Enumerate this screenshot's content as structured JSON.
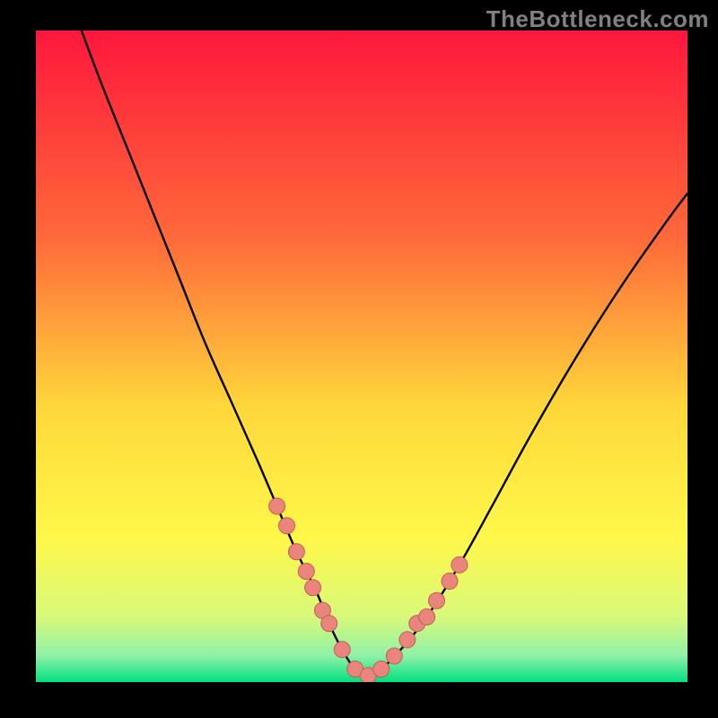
{
  "watermark": "TheBottleneck.com",
  "colors": {
    "frame": "#000000",
    "curve": "#000000",
    "dot_fill": "#e9857d",
    "dot_stroke": "#c25f56",
    "grad_top": "#ff173c",
    "grad_mid1": "#ff6a3a",
    "grad_mid2": "#ffd83a",
    "grad_mid3": "#fff84a",
    "grad_low1": "#d8f97a",
    "grad_low2": "#8ff1a8",
    "grad_bottom": "#00e07e"
  },
  "chart_data": {
    "type": "line",
    "title": "",
    "xlabel": "",
    "ylabel": "",
    "xlim": [
      0,
      100
    ],
    "ylim": [
      0,
      100
    ],
    "grid": false,
    "legend": false,
    "description": "V-shaped bottleneck curve over vertical rainbow gradient; minimum near x≈48, y≈0. Left branch rises steeply toward top-left; right branch rises toward mid-right. Salmon dots cluster along the lower portion of both branches and across the trough.",
    "series": [
      {
        "name": "curve",
        "x": [
          7,
          10,
          14,
          18,
          22,
          26,
          30,
          34,
          37,
          40,
          43,
          45,
          47,
          49,
          51,
          53,
          56,
          60,
          65,
          70,
          76,
          83,
          90,
          97,
          100
        ],
        "y": [
          100,
          92,
          82,
          72,
          62,
          52,
          43,
          34,
          27,
          20,
          14,
          9,
          5,
          2,
          1,
          2,
          5,
          10,
          18,
          27,
          38,
          50,
          61,
          71,
          75
        ]
      },
      {
        "name": "dots",
        "x": [
          37,
          38.5,
          40,
          41.5,
          42.5,
          44,
          45,
          47,
          49,
          51,
          53,
          55,
          57,
          58.5,
          60,
          61.5,
          63.5,
          65
        ],
        "y": [
          27,
          24,
          20,
          17,
          14.5,
          11,
          9,
          5,
          2,
          1,
          2,
          4,
          6.5,
          9,
          10,
          12.5,
          15.5,
          18
        ]
      }
    ]
  }
}
